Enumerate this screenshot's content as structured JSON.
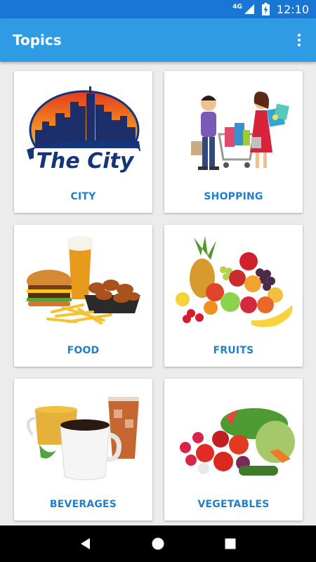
{
  "status_bar": {
    "network": "4G",
    "time": "12:10"
  },
  "app_bar": {
    "title": "Topics"
  },
  "topics": [
    {
      "label": "CITY",
      "image_caption": "The City"
    },
    {
      "label": "SHOPPING"
    },
    {
      "label": "FOOD"
    },
    {
      "label": "FRUITS"
    },
    {
      "label": "BEVERAGES"
    },
    {
      "label": "VEGETABLES"
    }
  ],
  "colors": {
    "status_bar": "#1976d2",
    "app_bar": "#2f9be4",
    "label": "#1f7fc9",
    "background": "#ececec"
  },
  "icons": {
    "menu": "more-vert-icon",
    "back": "back-icon",
    "home": "home-icon",
    "recents": "recents-icon"
  }
}
